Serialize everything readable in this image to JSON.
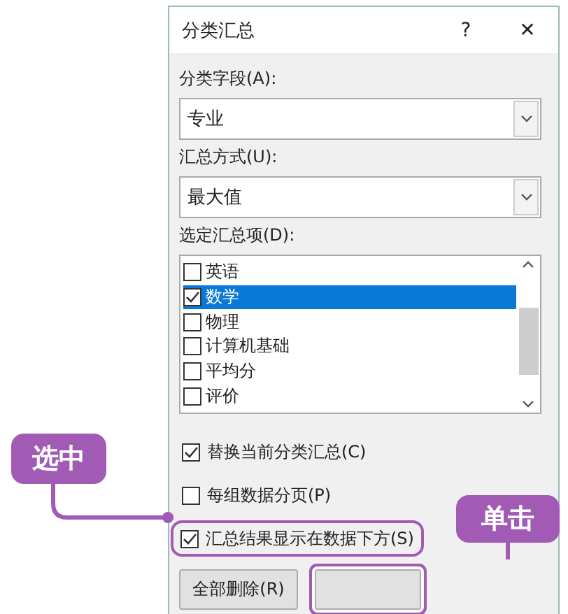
{
  "dialog": {
    "title": "分类汇总",
    "help_button": "?",
    "close_button": "✕"
  },
  "group_by": {
    "label": "分类字段(A):",
    "value": "专业"
  },
  "function": {
    "label": "汇总方式(U):",
    "value": "最大值"
  },
  "subtotal_items": {
    "label": "选定汇总项(D):",
    "items": [
      {
        "label": "英语",
        "checked": false,
        "selected": false
      },
      {
        "label": "数学",
        "checked": true,
        "selected": true
      },
      {
        "label": "物理",
        "checked": false,
        "selected": false
      },
      {
        "label": "计算机基础",
        "checked": false,
        "selected": false
      },
      {
        "label": "平均分",
        "checked": false,
        "selected": false
      },
      {
        "label": "评价",
        "checked": false,
        "selected": false
      }
    ]
  },
  "options": [
    {
      "label": "替换当前分类汇总(C)",
      "checked": true,
      "highlighted": false
    },
    {
      "label": "每组数据分页(P)",
      "checked": false,
      "highlighted": false
    },
    {
      "label": "汇总结果显示在数据下方(S)",
      "checked": true,
      "highlighted": true
    }
  ],
  "buttons": [
    {
      "label": "全部删除(R)",
      "highlighted": false
    },
    {
      "highlighted": true
    }
  ],
  "callouts": [
    {
      "text": "选中"
    },
    {
      "text": "单击"
    }
  ]
}
